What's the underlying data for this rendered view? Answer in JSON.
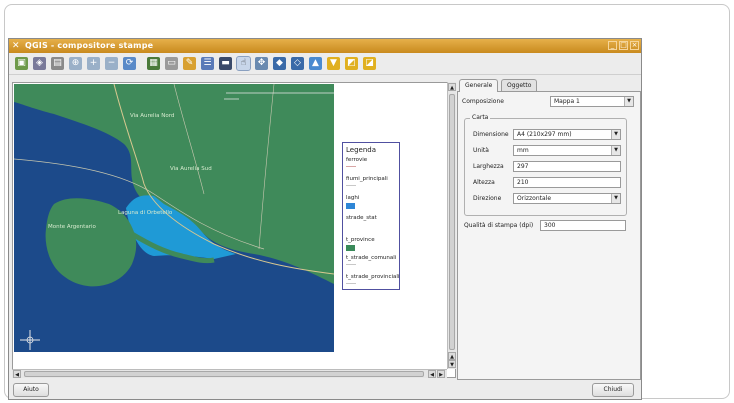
{
  "window": {
    "title": "QGIS - compositore stampe"
  },
  "map_labels": {
    "aurelia_nord": "Via Aurelia Nord",
    "aurelia_sud": "Via Aurelia Sud",
    "laguna": "Laguna di Orbetello",
    "argentario": "Monte Argentario"
  },
  "legend": {
    "title": "Legenda",
    "items": [
      "ferrovie",
      "fiumi_principali",
      "laghi",
      "strade_stat",
      "t_province",
      "t_strade_comunali",
      "t_strade_provinciali"
    ],
    "colors": {
      "laghi": "#2f86d6",
      "t_province": "#3a8a5a"
    }
  },
  "tabs": [
    {
      "label": "Generale"
    },
    {
      "label": "Oggetto"
    }
  ],
  "generale": {
    "composizione_label": "Composizione",
    "composizione_value": "Mappa 1",
    "carta_title": "Carta",
    "dimensione_label": "Dimensione",
    "dimensione_value": "A4 (210x297 mm)",
    "unita_label": "Unità",
    "unita_value": "mm",
    "larghezza_label": "Larghezza",
    "larghezza_value": "297",
    "altezza_label": "Altezza",
    "altezza_value": "210",
    "direzione_label": "Direzione",
    "direzione_value": "Orizzontale",
    "qualita_label": "Qualità di stampa (dpi)",
    "qualita_value": "300"
  },
  "buttons": {
    "aiuto": "Aiuto",
    "chiudi": "Chiudi"
  },
  "colors": {
    "titlebar": "#d89a32",
    "sea": "#1c4a8a",
    "land": "#3f8a5a",
    "lagoon": "#1f9ad6"
  }
}
